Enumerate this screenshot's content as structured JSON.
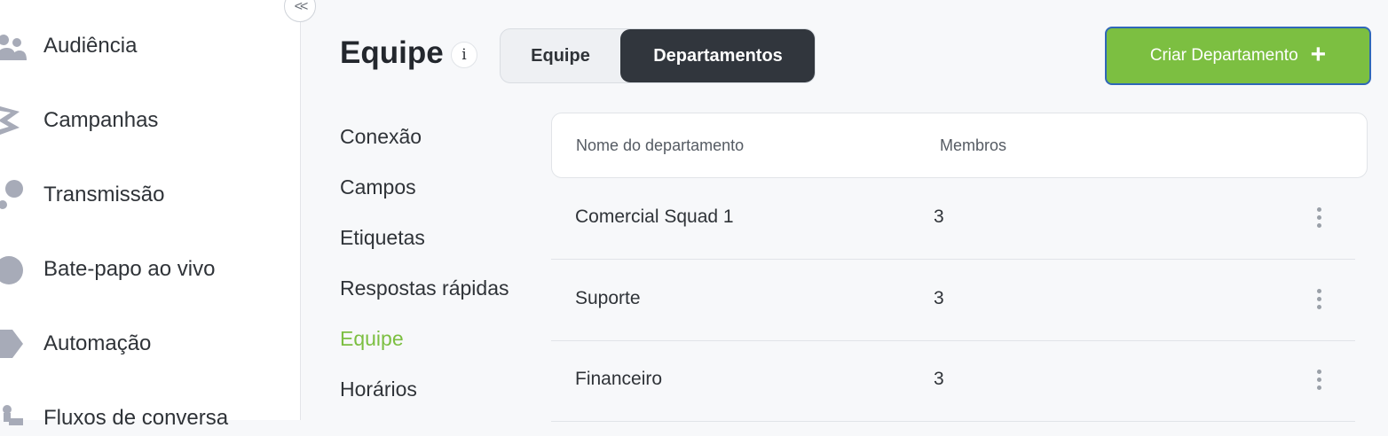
{
  "sidebar": {
    "collapse_label": "<<",
    "items": [
      {
        "label": "Audiência",
        "icon": "people-icon"
      },
      {
        "label": "Campanhas",
        "icon": "campaign-icon"
      },
      {
        "label": "Transmissão",
        "icon": "broadcast-icon"
      },
      {
        "label": "Bate-papo ao vivo",
        "icon": "chat-icon"
      },
      {
        "label": "Automação",
        "icon": "automation-icon"
      },
      {
        "label": "Fluxos de conversa",
        "icon": "flow-icon"
      }
    ]
  },
  "header": {
    "title": "Equipe",
    "info_label": "i",
    "tabs": [
      {
        "label": "Equipe",
        "active": false
      },
      {
        "label": "Departamentos",
        "active": true
      }
    ],
    "create_button": {
      "label": "Criar Departamento",
      "icon": "+"
    }
  },
  "submenu": {
    "items": [
      {
        "label": "Conexão",
        "active": false
      },
      {
        "label": "Campos",
        "active": false
      },
      {
        "label": "Etiquetas",
        "active": false
      },
      {
        "label": "Respostas rápidas",
        "active": false
      },
      {
        "label": "Equipe",
        "active": true
      },
      {
        "label": "Horários",
        "active": false
      }
    ]
  },
  "table": {
    "columns": [
      "Nome do departamento",
      "Membros"
    ],
    "rows": [
      {
        "name": "Comercial Squad 1",
        "members": "3"
      },
      {
        "name": "Suporte",
        "members": "3"
      },
      {
        "name": "Financeiro",
        "members": "3"
      }
    ]
  },
  "colors": {
    "accent": "#7cbf41",
    "dark_tab": "#31363d",
    "focus_border": "#2f67b8"
  }
}
